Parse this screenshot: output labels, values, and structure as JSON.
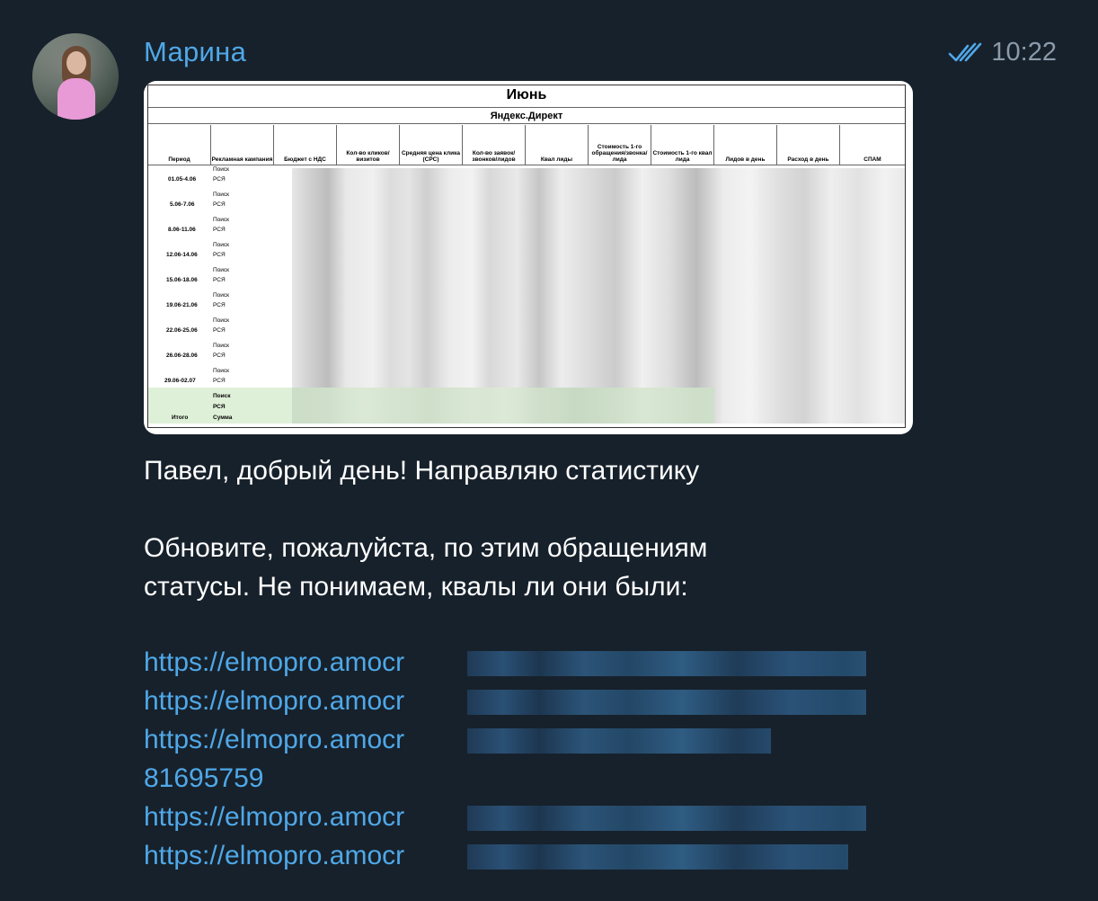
{
  "message": {
    "sender": "Марина",
    "time": "10:22",
    "status_icon": "double-check-icon",
    "text_line_1": "Павел, добрый день! Направляю статистику",
    "text_line_2": "Обновите, пожалуйста, по этим обращениям",
    "text_line_3": "статусы. Не понимаем, квалы ли они были:",
    "links": [
      "https://elmopro.amocr",
      "https://elmopro.amocr",
      "https://elmopro.amocr",
      "81695759",
      "https://elmopro.amocr",
      "https://elmopro.amocr"
    ]
  },
  "spreadsheet": {
    "title": "Июнь",
    "subtitle": "Яндекс.Директ",
    "headers": [
      "Период",
      "Рекламная кампания",
      "Бюджет с НДС",
      "Кол-во кликов/визитов",
      "Средняя цена клика (CPC)",
      "Кол-во заявок/звонков/лидов",
      "Квал лиды",
      "Стоимость 1-го обращения/звонка/лида",
      "Стоимость 1-го квал лида",
      "Лидов в день",
      "Расход в день",
      "СПАМ"
    ],
    "periods": [
      "01.05-4.06",
      "5.06-7.06",
      "8.06-11.06",
      "12.06-14.06",
      "15.06-18.06",
      "19.06-21.06",
      "22.06-25.06",
      "26.06-28.06",
      "29.06-02.07"
    ],
    "campaign_search": "Поиск",
    "campaign_rsya": "РСЯ",
    "total_label": "Итого",
    "total_rows": [
      "Поиск",
      "РСЯ",
      "Сумма"
    ]
  }
}
